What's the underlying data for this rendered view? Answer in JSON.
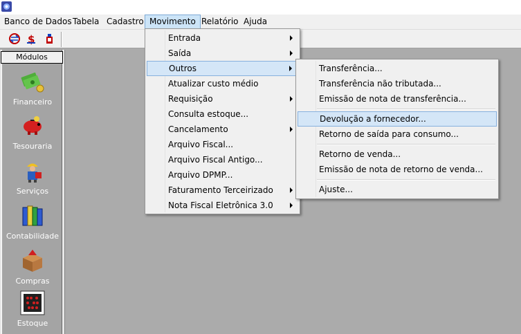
{
  "menubar": {
    "items": [
      "Banco de Dados",
      "Tabela",
      "Cadastro",
      "Movimento",
      "Relatório",
      "Ajuda"
    ],
    "active": "Movimento"
  },
  "sidebar": {
    "header": "Módulos",
    "modules": [
      {
        "label": "Financeiro",
        "icon": "money-icon"
      },
      {
        "label": "Tesouraria",
        "icon": "piggy-bank-icon"
      },
      {
        "label": "Serviços",
        "icon": "worker-icon"
      },
      {
        "label": "Contabilidade",
        "icon": "books-icon"
      },
      {
        "label": "Compras",
        "icon": "box-icon"
      },
      {
        "label": "Estoque",
        "icon": "abacus-icon"
      }
    ]
  },
  "movimento_menu": {
    "items": [
      {
        "label": "Entrada",
        "submenu": true
      },
      {
        "label": "Saída",
        "submenu": true
      },
      {
        "label": "Outros",
        "submenu": true,
        "highlighted": true
      },
      {
        "label": "Atualizar custo médio",
        "submenu": false
      },
      {
        "label": "Requisição",
        "submenu": true
      },
      {
        "label": "Consulta estoque...",
        "submenu": false
      },
      {
        "label": "Cancelamento",
        "submenu": true
      },
      {
        "label": "Arquivo Fiscal...",
        "submenu": false
      },
      {
        "label": "Arquivo Fiscal Antigo...",
        "submenu": false
      },
      {
        "label": "Arquivo DPMP...",
        "submenu": false
      },
      {
        "label": "Faturamento Terceirizado",
        "submenu": true
      },
      {
        "label": "Nota Fiscal Eletrônica 3.0",
        "submenu": true
      }
    ]
  },
  "outros_menu": {
    "items": [
      {
        "label": "Transferência..."
      },
      {
        "label": "Transferência não tributada..."
      },
      {
        "label": "Emissão de nota de transferência..."
      },
      {
        "label": "Devolução a fornecedor...",
        "highlighted": true
      },
      {
        "label": "Retorno de saída para consumo..."
      },
      {
        "label": "Retorno de venda..."
      },
      {
        "label": "Emissão de nota de retorno de venda..."
      },
      {
        "label": "Ajuste..."
      }
    ]
  },
  "colors": {
    "workspace": "#ababab",
    "highlight": "#d4e6f7",
    "menu_bg": "#f0f0f0"
  }
}
